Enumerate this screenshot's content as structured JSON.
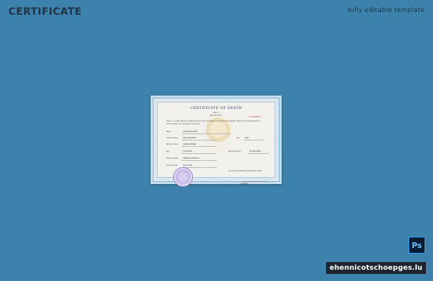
{
  "header": {
    "title": "CERTIFICATE",
    "tagline": "fully editable template"
  },
  "certificate": {
    "title": "CERTIFICATE OF DEATH",
    "subtitle_1": "NO. II",
    "subtitle_2": "ZH-DV-0271",
    "number": "№ 0000001",
    "intro": "This is to certify that the original record of this certificate is on file in the Register Office of the Municipality of",
    "intro_2": "Zurich, Swiss, concerning the death of:",
    "fields": [
      {
        "label": "Name",
        "value": "FRANZ MUSTER"
      },
      {
        "label": "Father's Name",
        "value": "PAUL MUSTER"
      },
      {
        "label": "Sex",
        "value": "Male"
      },
      {
        "label": "Mother's Name",
        "value": "ANNA MUSTER"
      },
      {
        "label": "Age",
        "value": "63 YEARS"
      },
      {
        "label": "Registration No.",
        "value": "ZH 2019-0001"
      },
      {
        "label": "Place of Death",
        "value": "ZURICH HOSPITAL"
      },
      {
        "label": "Date of Death",
        "value": "01.01.2019"
      }
    ],
    "signature_note": "Issued and certified by the Register Office",
    "signature_label": "Registrar"
  },
  "badges": {
    "app_icon": "Ps",
    "app_icon_name": "photoshop-icon",
    "brand": "ehennicotschoepges.lu"
  }
}
